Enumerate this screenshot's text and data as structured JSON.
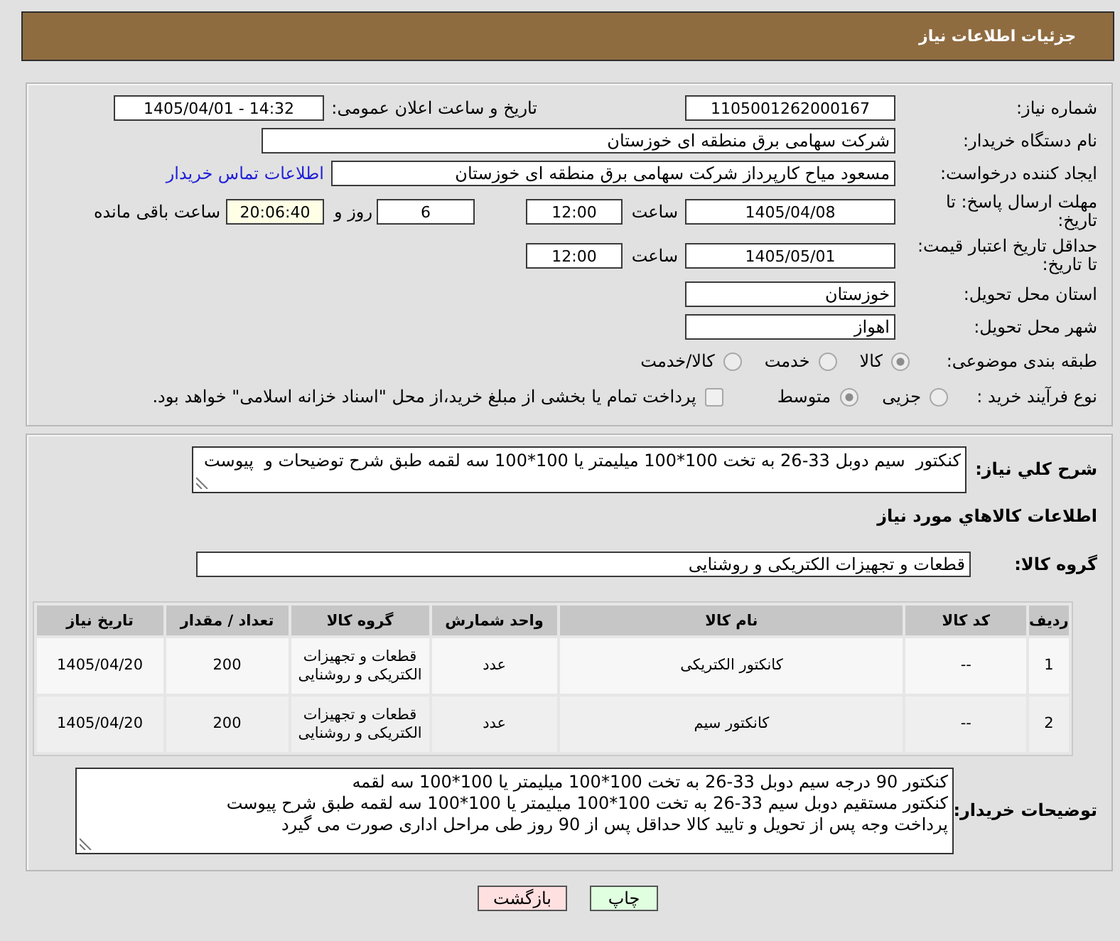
{
  "header": {
    "title": "جزئیات اطلاعات نیاز"
  },
  "details": {
    "need_number": {
      "label": "شماره نیاز:",
      "value": "1105001262000167"
    },
    "announce_datetime": {
      "label": "تاریخ و ساعت اعلان عمومی:",
      "value": "1405/04/01 - 14:32"
    },
    "buyer_org": {
      "label": "نام دستگاه خریدار:",
      "value": "شرکت سهامی برق منطقه ای خوزستان"
    },
    "requester": {
      "label": "ایجاد کننده درخواست:",
      "value": "مسعود میاح کارپرداز شرکت سهامی برق منطقه ای خوزستان",
      "link": "اطلاعات تماس خریدار"
    },
    "response_deadline": {
      "label_lines": [
        "مهلت ارسال پاسخ: تا",
        "تاریخ:"
      ],
      "date": "1405/04/08",
      "time_label": "ساعت",
      "time": "12:00",
      "days": "6",
      "days_label": "روز و",
      "remaining": "20:06:40",
      "remaining_label": "ساعت باقی مانده"
    },
    "price_validity": {
      "label_lines": [
        "حداقل تاریخ اعتبار قیمت:",
        "تا تاریخ:"
      ],
      "date": "1405/05/01",
      "time_label": "ساعت",
      "time": "12:00"
    },
    "province": {
      "label": "استان محل تحویل:",
      "value": "خوزستان"
    },
    "city": {
      "label": "شهر محل تحویل:",
      "value": "اهواز"
    },
    "category": {
      "label": "طبقه بندی موضوعی:",
      "options": [
        {
          "label": "کالا",
          "selected": true
        },
        {
          "label": "خدمت",
          "selected": false
        },
        {
          "label": "کالا/خدمت",
          "selected": false
        }
      ]
    },
    "purchase_process": {
      "label": "نوع فرآیند خرید :",
      "options": [
        {
          "label": "جزیی",
          "selected": false
        },
        {
          "label": "متوسط",
          "selected": true
        }
      ],
      "treasury_payment": {
        "label": "پرداخت تمام یا بخشی از مبلغ خرید،از محل \"اسناد خزانه اسلامی\" خواهد بود.",
        "checked": false
      }
    }
  },
  "summary": {
    "label": "شرح کلي نياز:",
    "value": "کنکتور  سیم دوبل 33-26 به تخت 100*100 میلیمتر یا 100*100 سه لقمه طبق شرح توضیحات و  پیوست"
  },
  "items_heading": "اطلاعات کالاهاي مورد نياز",
  "goods_group": {
    "label": "گروه کالا:",
    "value": "قطعات و تجهیزات الکتریکی و روشنایی"
  },
  "table": {
    "columns": [
      "ردیف",
      "کد کالا",
      "نام کالا",
      "واحد شمارش",
      "گروه کالا",
      "تعداد / مقدار",
      "تاریخ نیاز"
    ],
    "rows": [
      [
        "1",
        "--",
        "کانکتور الکتریکی",
        "عدد",
        "قطعات و تجهیزات الکتریکی و روشنایی",
        "200",
        "1405/04/20"
      ],
      [
        "2",
        "--",
        "کانکتور سیم",
        "عدد",
        "قطعات و تجهیزات الکتریکی و روشنایی",
        "200",
        "1405/04/20"
      ]
    ]
  },
  "buyer_notes": {
    "label": "توضیحات خریدار:",
    "lines": [
      "کنکتور 90 درجه سیم دوبل 33-26 به تخت 100*100 میلیمتر یا 100*100 سه لقمه",
      "کنکتور مستقیم دوبل سیم 33-26 به تخت 100*100 میلیمتر یا 100*100 سه لقمه طبق شرح پیوست",
      "پرداخت وجه پس از تحویل و تایید کالا حداقل پس از 90 روز طی مراحل اداری صورت می گیرد"
    ]
  },
  "buttons": [
    {
      "kind": "print",
      "label": "چاپ"
    },
    {
      "kind": "back",
      "label": "بازگشت"
    }
  ]
}
